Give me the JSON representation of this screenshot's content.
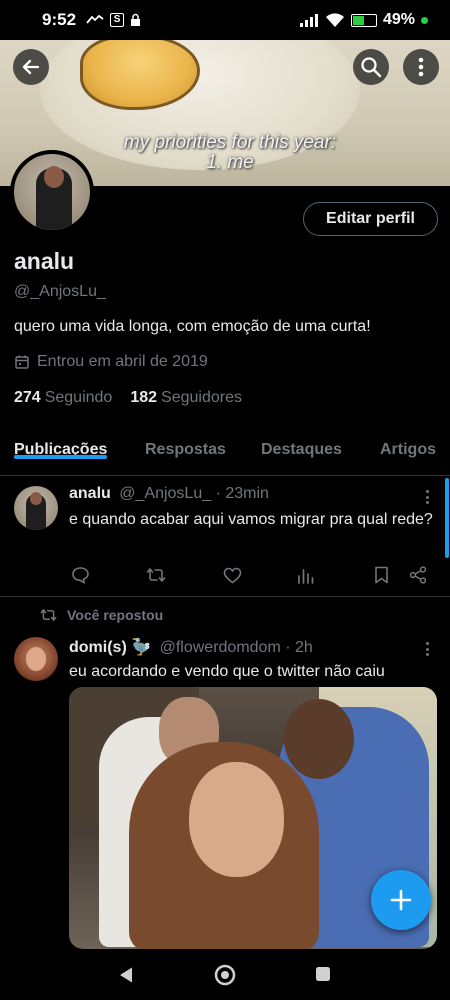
{
  "status_bar": {
    "time": "9:52",
    "battery": "49%"
  },
  "banner": {
    "caption_line1": "my priorities for this year:",
    "caption_line2": "1. me"
  },
  "profile": {
    "edit_label": "Editar perfil",
    "display_name": "analu",
    "handle": "@_AnjosLu_",
    "bio": "quero uma vida longa, com emoção de uma curta!",
    "joined": "Entrou em abril de 2019",
    "following_count": "274",
    "following_label": "Seguindo",
    "followers_count": "182",
    "followers_label": "Seguidores"
  },
  "tabs": [
    {
      "label": "Publicações",
      "active": true
    },
    {
      "label": "Respostas",
      "active": false
    },
    {
      "label": "Destaques",
      "active": false
    },
    {
      "label": "Artigos",
      "active": false
    }
  ],
  "tweets": [
    {
      "name": "analu",
      "handle": "@_AnjosLu_",
      "time": "· 23min",
      "text": "e quando acabar aqui vamos migrar pra qual rede?"
    },
    {
      "repost_label": "Você repostou",
      "name": "domi(s) 🦤",
      "handle": "@flowerdomdom",
      "time": "· 2h",
      "text": "eu acordando e vendo que o twitter não caiu"
    }
  ],
  "colors": {
    "accent": "#1d9bf0",
    "background": "#000000",
    "secondary_text": "#71767b"
  }
}
